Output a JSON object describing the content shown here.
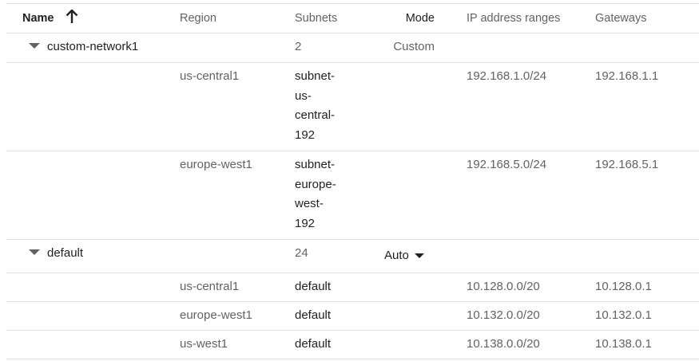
{
  "header": {
    "name": "Name",
    "region": "Region",
    "subnets": "Subnets",
    "mode": "Mode",
    "ip_ranges": "IP address ranges",
    "gateways": "Gateways"
  },
  "networks": [
    {
      "name": "custom-network1",
      "subnets_count": "2",
      "mode": "Custom",
      "subnets": [
        {
          "region": "us-central1",
          "name_lines": [
            "subnet-",
            "us-",
            "central-",
            "192"
          ],
          "ip_range": "192.168.1.0/24",
          "gateway": "192.168.1.1"
        },
        {
          "region": "europe-west1",
          "name_lines": [
            "subnet-",
            "europe-",
            "west-",
            "192"
          ],
          "ip_range": "192.168.5.0/24",
          "gateway": "192.168.5.1"
        }
      ]
    },
    {
      "name": "default",
      "subnets_count": "24",
      "mode": "Auto",
      "subnets": [
        {
          "region": "us-central1",
          "name": "default",
          "ip_range": "10.128.0.0/20",
          "gateway": "10.128.0.1"
        },
        {
          "region": "europe-west1",
          "name": "default",
          "ip_range": "10.132.0.0/20",
          "gateway": "10.132.0.1"
        },
        {
          "region": "us-west1",
          "name": "default",
          "ip_range": "10.138.0.0/20",
          "gateway": "10.138.0.1"
        }
      ]
    }
  ],
  "colors": {
    "border": "#e0e0e0",
    "muted_text": "#5f6368",
    "dark_text": "#202124"
  },
  "icons": {
    "sort": "arrow-up-icon",
    "expand": "caret-down-icon",
    "dropdown": "dropdown-caret-icon"
  }
}
